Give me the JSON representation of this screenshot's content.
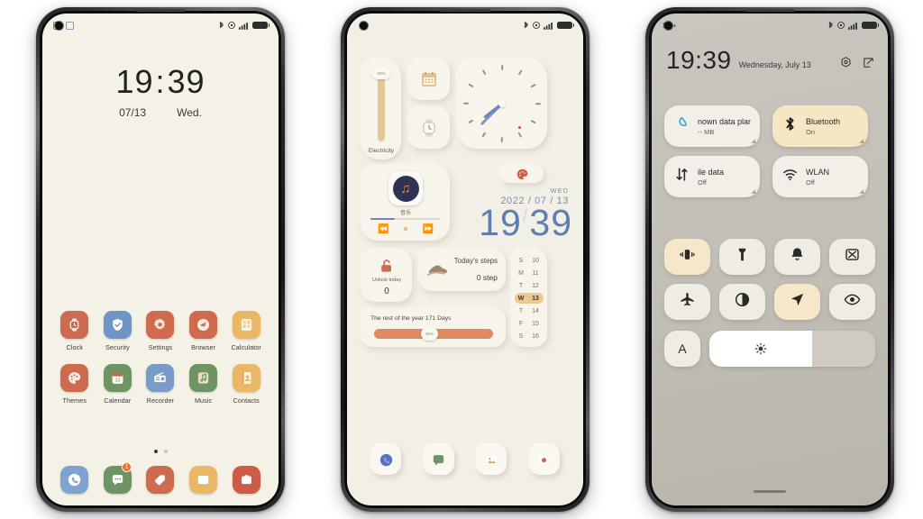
{
  "meta": {
    "bg": "#ffffff",
    "accent_terracotta": "#c8604a",
    "accent_blue": "#6d86b4",
    "accent_amber": "#e9c990"
  },
  "phone1": {
    "screen_bg": "#f4f1e6",
    "statusbar": {
      "notif_icons": [
        "app-notification-icon",
        "app-notification-icon"
      ],
      "right_icons": [
        "bluetooth-icon",
        "alarm-icon",
        "signal-icon",
        "battery-icon"
      ]
    },
    "clock": {
      "hours": "19",
      "colon": ":",
      "minutes": "39",
      "date": "07/13",
      "weekday": "Wed."
    },
    "apps": [
      {
        "label": "Clock",
        "icon": "watch-icon",
        "bg": "#ce6a50",
        "fg": "#f7ede2"
      },
      {
        "label": "Security",
        "icon": "shield-icon",
        "bg": "#6d96c6",
        "fg": "#ffffff"
      },
      {
        "label": "Settings",
        "icon": "gear-icon",
        "bg": "#cf6a4f",
        "fg": "#f3e6d6"
      },
      {
        "label": "Browser",
        "icon": "compass-icon",
        "bg": "#cf6a4f",
        "fg": "#f7efe3"
      },
      {
        "label": "Calculator",
        "icon": "calculator-icon",
        "bg": "#e9b765",
        "fg": "#fdf6e8"
      },
      {
        "label": "Themes",
        "icon": "palette-icon",
        "bg": "#ce6a50",
        "fg": "#f7ede2"
      },
      {
        "label": "Calendar",
        "icon": "calendar-icon",
        "bg": "#6f9464",
        "fg": "#fdf8ee",
        "day": "13"
      },
      {
        "label": "Recorder",
        "icon": "radio-icon",
        "bg": "#7a9bc7",
        "fg": "#fdfaf3"
      },
      {
        "label": "Music",
        "icon": "music-note-icon",
        "bg": "#6f9464",
        "fg": "#f0dcc3"
      },
      {
        "label": "Contacts",
        "icon": "contacts-icon",
        "bg": "#e9b765",
        "fg": "#fdf6e8"
      }
    ],
    "page_dots": {
      "active_index": 0,
      "count": 2
    },
    "dock": [
      {
        "label": "Phone",
        "icon": "phone-icon",
        "bg": "#7fa3d0",
        "fg": "#ffffff",
        "badge": ""
      },
      {
        "label": "Messages",
        "icon": "message-icon",
        "bg": "#6f9464",
        "fg": "#ffffff",
        "badge": "1"
      },
      {
        "label": "Notes",
        "icon": "tag-icon",
        "bg": "#ce6a50",
        "fg": "#ffffff",
        "badge": ""
      },
      {
        "label": "Gallery",
        "icon": "gallery-icon",
        "bg": "#e9b765",
        "fg": "#ffffff",
        "badge": ""
      },
      {
        "label": "Camera",
        "icon": "camera-icon",
        "bg": "#cf5a46",
        "fg": "#ffffff",
        "badge": ""
      }
    ]
  },
  "phone2": {
    "screen_bg": "#f2efe6",
    "electricity": {
      "label": "Electricity",
      "value": "90%"
    },
    "calendar_widget": {
      "icon": "calendar-icon"
    },
    "watch_widget": {
      "icon": "watch-icon"
    },
    "analog_clock": {
      "hour_angle": 232,
      "minute_angle": 225,
      "ticks": 12
    },
    "music": {
      "title": "音乐",
      "icon": "music-note-icon",
      "progress_pct": 34,
      "controls": [
        "prev-icon",
        "pause-icon",
        "next-icon"
      ]
    },
    "themes_pill": {
      "icon": "palette-icon"
    },
    "datetime": {
      "weekday": "WED",
      "date": "2022 / 07 / 13",
      "hours": "19",
      "sep": "/",
      "minutes": "39"
    },
    "unlock": {
      "icon": "unlock-icon",
      "label": "Unlock today",
      "value": "0"
    },
    "steps": {
      "icon": "shoe-icon",
      "title": "Today's steps",
      "value": "0  step"
    },
    "year_progress": {
      "text_prefix": "The rest of the year",
      "days": "171",
      "text_suffix": "Days",
      "percent": "46%",
      "percent_value": 46
    },
    "week": [
      {
        "d": "S",
        "n": "10",
        "today": false
      },
      {
        "d": "M",
        "n": "11",
        "today": false
      },
      {
        "d": "T",
        "n": "12",
        "today": false
      },
      {
        "d": "W",
        "n": "13",
        "today": true
      },
      {
        "d": "T",
        "n": "14",
        "today": false
      },
      {
        "d": "F",
        "n": "15",
        "today": false
      },
      {
        "d": "S",
        "n": "16",
        "today": false
      }
    ],
    "dock": [
      {
        "label": "Phone",
        "icon": "phone-icon",
        "fg": "#5b6fc0"
      },
      {
        "label": "Messages",
        "icon": "message-icon",
        "fg": "#6f9464"
      },
      {
        "label": "Gallery",
        "icon": "gallery-icon",
        "fg": "#e3a552"
      },
      {
        "label": "Camera",
        "icon": "camera-icon",
        "fg": "#d2603f"
      }
    ]
  },
  "phone3": {
    "screen_bg": "#c5c2ba",
    "carrier": "SA+",
    "statusbar_right": [
      "bluetooth-icon",
      "alarm-icon",
      "signal-icon",
      "battery-icon"
    ],
    "header": {
      "time": "19:39",
      "date": "Wednesday, July 13",
      "icons": [
        "settings-gear-icon",
        "edit-icon"
      ]
    },
    "big_tiles": [
      {
        "title": "nown data plan",
        "subtitle": "-- MB",
        "icon": "data-drop-icon",
        "on": false,
        "icon_color": "#3ea7e0"
      },
      {
        "title": "Bluetooth",
        "subtitle": "On",
        "icon": "bluetooth-icon",
        "on": true,
        "icon_color": "#1c1c1c"
      },
      {
        "title": "ile data",
        "subtitle": "Off",
        "icon": "data-arrows-icon",
        "on": false,
        "icon_color": "#2b2a26"
      },
      {
        "title": "WLAN",
        "subtitle": "Off",
        "icon": "wifi-icon",
        "on": false,
        "icon_color": "#2b2a26"
      }
    ],
    "toggles": [
      {
        "name": "vibrate",
        "icon": "vibrate-icon",
        "on": true
      },
      {
        "name": "flashlight",
        "icon": "flashlight-icon",
        "on": false
      },
      {
        "name": "ringer",
        "icon": "bell-icon",
        "on": false
      },
      {
        "name": "screenshot",
        "icon": "screenshot-icon",
        "on": false
      },
      {
        "name": "airplane",
        "icon": "airplane-icon",
        "on": false
      },
      {
        "name": "dark-mode",
        "icon": "contrast-icon",
        "on": false
      },
      {
        "name": "location",
        "icon": "location-icon",
        "on": true
      },
      {
        "name": "eye-care",
        "icon": "eye-icon",
        "on": false
      }
    ],
    "brightness": {
      "auto_label": "A",
      "icon": "sun-icon",
      "level_pct": 62
    }
  }
}
